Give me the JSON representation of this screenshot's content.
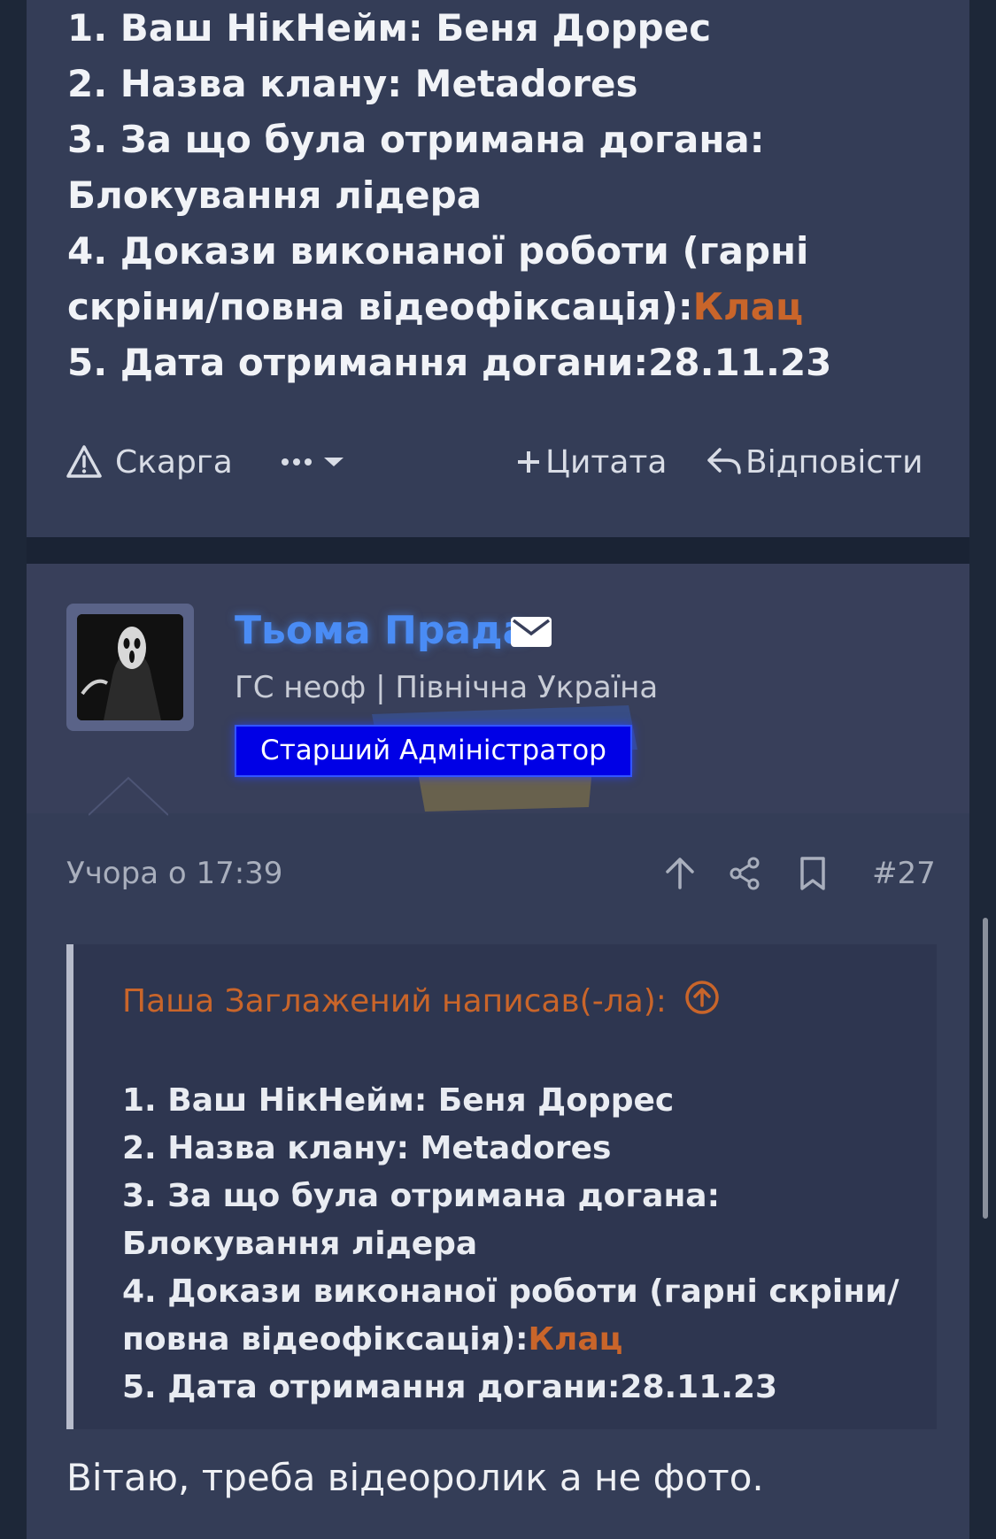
{
  "previous_post": {
    "lines": [
      "1. Ваш НікНейм: Беня Доррес",
      "2. Назва клану: Metadores",
      "3. За що була отримана догана:",
      "Блокування лідера",
      "4. Докази виконаної роботи (гарні",
      "скріни/повна відеофіксація):",
      "5. Дата отримання догани:28.11.23"
    ],
    "link_text": "Клац",
    "actions": {
      "report": "Скарга",
      "quote": "Цитата",
      "reply": "Відповісти"
    }
  },
  "post": {
    "username": "Тьома Прада",
    "user_title": "ГС неоф | Північна Україна",
    "role": "Старший Адміністратор",
    "timestamp": "Учора о 17:39",
    "post_number": "#27",
    "quote": {
      "header": "Паша Заглажений написав(-ла):",
      "lines": [
        "1. Ваш НікНейм: Беня Доррес",
        "2. Назва клану: Metadores",
        "3. За що була отримана догана:",
        "Блокування лідера",
        "4. Докази виконаної роботи (гарні скріни/",
        "повна відеофіксація):",
        "5. Дата отримання догани:28.11.23"
      ],
      "link_text": "Клац"
    },
    "reply_text": "Вітаю, треба відеоролик а не фото."
  },
  "icons": {
    "report": "warning-triangle-icon",
    "more": "more-dots-icon",
    "quote": "plus-icon",
    "reply": "reply-arrow-icon",
    "mail": "envelope-icon",
    "upvote": "arrow-up-icon",
    "share": "share-icon",
    "bookmark": "bookmark-icon",
    "quote_jump": "circle-arrow-up-icon"
  },
  "colors": {
    "link": "#c9652a",
    "username": "#4a8cf5",
    "role_badge": "#0000e6",
    "card": "#343d57"
  }
}
